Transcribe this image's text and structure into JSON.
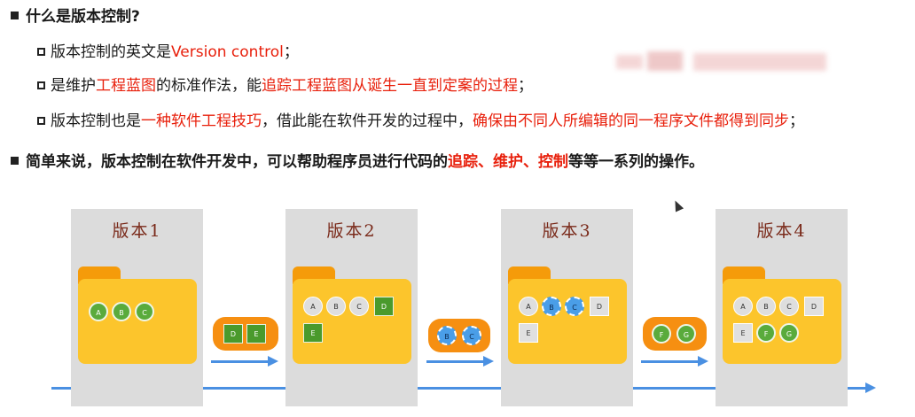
{
  "heading": {
    "title": "什么是版本控制?"
  },
  "points": [
    {
      "segs": [
        [
          "版本控制的英文是",
          false
        ],
        [
          "Version control",
          true
        ],
        [
          "；",
          false
        ]
      ]
    },
    {
      "segs": [
        [
          "是维护",
          false
        ],
        [
          "工程蓝图",
          true
        ],
        [
          "的标准作法，能",
          false
        ],
        [
          "追踪工程蓝图从诞生一直到定案的过程",
          true
        ],
        [
          "；",
          false
        ]
      ]
    },
    {
      "segs": [
        [
          "版本控制也是",
          false
        ],
        [
          "一种软件工程技巧",
          true
        ],
        [
          "，借此能在软件开发的过程中，",
          false
        ],
        [
          "确保由不同人所编辑的同一程序文件都得到同步",
          true
        ],
        [
          "；",
          false
        ]
      ]
    }
  ],
  "summary": {
    "segs": [
      [
        "简单来说，版本控制在软件开发中，可以帮助程序员进行代码的",
        false
      ],
      [
        "追踪、维护、控制",
        true
      ],
      [
        "等等一系列的操作。",
        false
      ]
    ]
  },
  "versions": [
    {
      "label": "版本1",
      "items": [
        "A",
        "B",
        "C"
      ]
    },
    {
      "label": "版本2",
      "items": [
        "A",
        "B",
        "C",
        "D",
        "E"
      ]
    },
    {
      "label": "版本3",
      "items": [
        "A",
        "B",
        "C",
        "D",
        "E"
      ]
    },
    {
      "label": "版本4",
      "items": [
        "A",
        "B",
        "C",
        "D",
        "E",
        "F",
        "G"
      ]
    }
  ],
  "transitions": [
    {
      "items": [
        "D",
        "E"
      ]
    },
    {
      "items": [
        "B",
        "C"
      ]
    },
    {
      "items": [
        "F",
        "G"
      ]
    }
  ],
  "colors": {
    "accent_red": "#e8200c",
    "folder": "#fcc52c",
    "folder_tab": "#f59b0a",
    "arrow": "#4a90e2",
    "panel": "#dcdcdc"
  }
}
